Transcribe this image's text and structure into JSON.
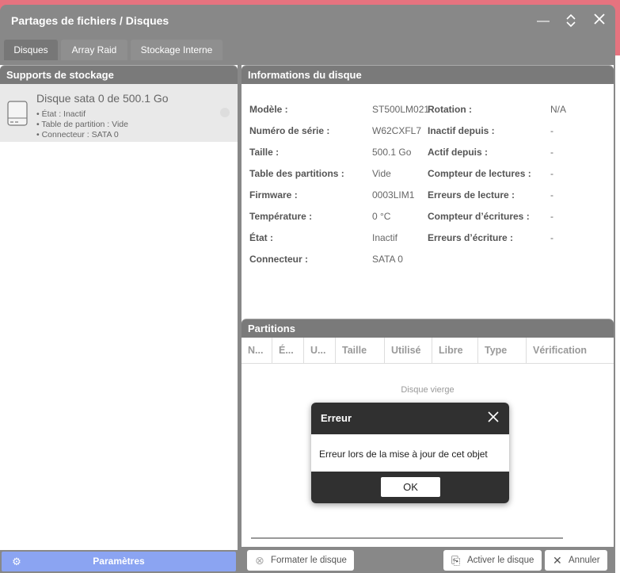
{
  "window": {
    "title": "Partages de fichiers / Disques"
  },
  "tabs": [
    {
      "label": "Disques"
    },
    {
      "label": "Array Raid"
    },
    {
      "label": "Stockage Interne"
    }
  ],
  "left": {
    "header": "Supports de stockage",
    "disk": {
      "title": "Disque sata 0 de 500.1 Go",
      "state": "• État : Inactif",
      "partition": "• Table de partition : Vide",
      "connector": "• Connecteur : SATA 0"
    },
    "params_label": "Paramètres"
  },
  "info": {
    "header": "Informations du disque",
    "left_rows": [
      {
        "label": "Modèle :",
        "value": "ST500LM021"
      },
      {
        "label": "Numéro de série :",
        "value": "W62CXFL7"
      },
      {
        "label": "Taille :",
        "value": "500.1 Go"
      },
      {
        "label": "Table des partitions :",
        "value": "Vide"
      },
      {
        "label": "Firmware :",
        "value": "0003LIM1"
      },
      {
        "label": "Température :",
        "value": "0 °C"
      },
      {
        "label": "État :",
        "value": "Inactif"
      },
      {
        "label": "Connecteur :",
        "value": "SATA 0"
      }
    ],
    "right_rows": [
      {
        "label": "Rotation :",
        "value": "N/A"
      },
      {
        "label": "Inactif depuis :",
        "value": "-"
      },
      {
        "label": "Actif depuis :",
        "value": "-"
      },
      {
        "label": "Compteur de lectures :",
        "value": "-"
      },
      {
        "label": "Erreurs de lecture :",
        "value": "-"
      },
      {
        "label": "Compteur d’écritures :",
        "value": "-"
      },
      {
        "label": "Erreurs d’écriture :",
        "value": "-"
      }
    ]
  },
  "partitions": {
    "header": "Partitions",
    "columns": [
      "N...",
      "É...",
      "U...",
      "Taille",
      "Utilisé",
      "Libre",
      "Type",
      "Vérification"
    ],
    "empty_text": "Disque vierge"
  },
  "footer": {
    "format_label": "Formater le disque",
    "activate_label": "Activer le disque",
    "cancel_label": "Annuler"
  },
  "dialog": {
    "title": "Erreur",
    "message": "Erreur lors de la mise à jour de cet objet",
    "ok_label": "OK"
  },
  "colors": {
    "accent": "#8ba4f2",
    "background": "#e6737f",
    "window": "#888888",
    "dialog_dark": "#303030"
  }
}
